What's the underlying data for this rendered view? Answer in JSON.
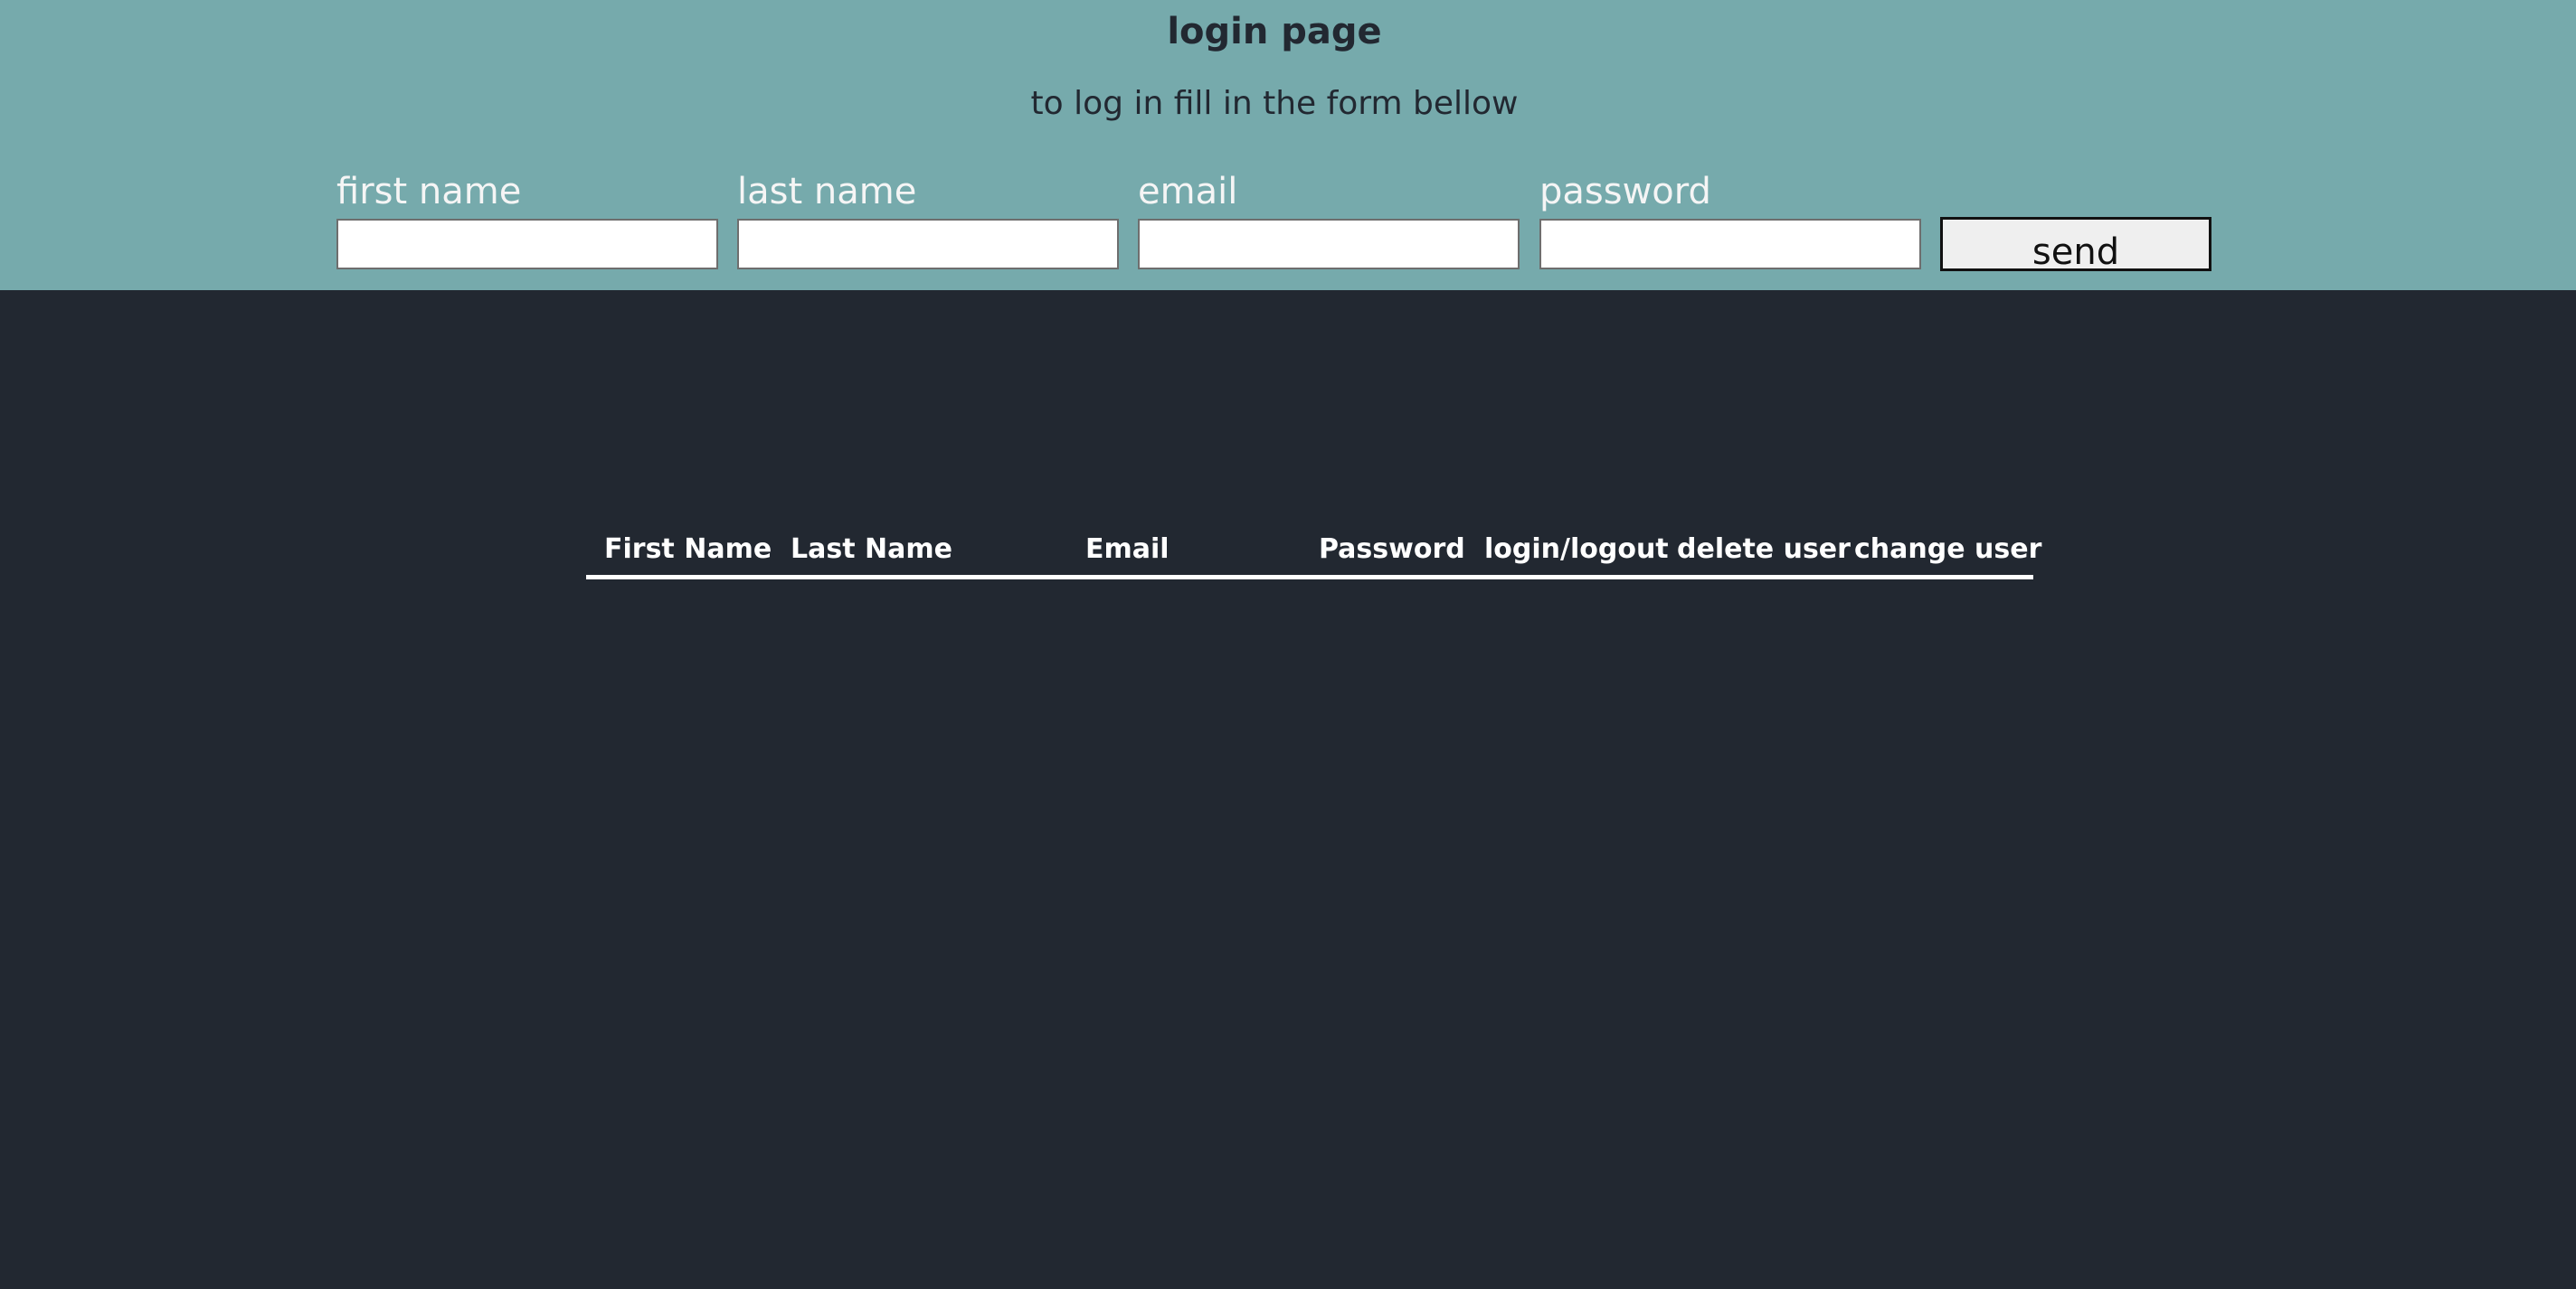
{
  "header": {
    "title": "login page",
    "subtitle": "to log in fill in the form bellow",
    "background_color": "#76aaac"
  },
  "form": {
    "fields": [
      {
        "label": "first name",
        "value": ""
      },
      {
        "label": "last name",
        "value": ""
      },
      {
        "label": "email",
        "value": ""
      },
      {
        "label": "password",
        "value": ""
      }
    ],
    "send_label": "send"
  },
  "table": {
    "columns": [
      "First Name",
      "Last Name",
      "Email",
      "Password",
      "login/logout",
      "delete user",
      "change user"
    ],
    "rows": []
  },
  "colors": {
    "page_background": "#222831",
    "text_light": "#ffffff"
  }
}
